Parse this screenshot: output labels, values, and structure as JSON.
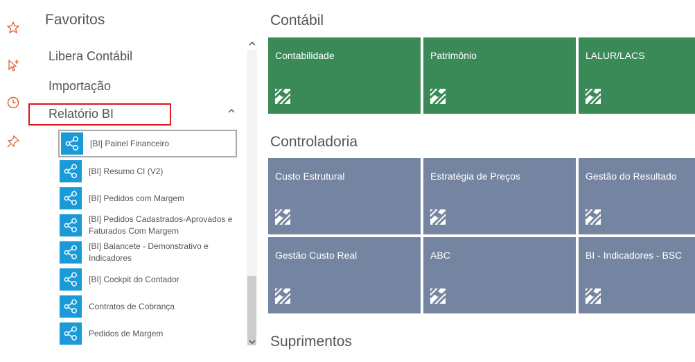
{
  "rail": {
    "icons": [
      "star-icon",
      "cursor-plus-icon",
      "clock-icon",
      "pin-icon"
    ],
    "accent_color": "#e0592a"
  },
  "favorites": {
    "title": "Favoritos",
    "items": [
      {
        "label": "Libera Contábil"
      },
      {
        "label": "Importação"
      },
      {
        "label": "Relatório BI",
        "expanded": true
      }
    ],
    "highlight_color": "#e0161b",
    "reports": [
      {
        "label": "[BI] Painel Financeiro",
        "selected": true
      },
      {
        "label": "[BI] Resumo CI (V2)"
      },
      {
        "label": "[BI] Pedidos com Margem"
      },
      {
        "label": "[BI] Pedidos Cadastrados-Aprovados e Faturados Com Margem"
      },
      {
        "label": "[BI] Balancete - Demonstrativo e Indicadores"
      },
      {
        "label": "[BI] Cockpit do Contador"
      },
      {
        "label": "Contratos de Cobrança"
      },
      {
        "label": "Pedidos de Margem"
      }
    ],
    "report_icon_color": "#1a9ad6"
  },
  "sections": [
    {
      "title": "Contábil",
      "color": "#3a8a57",
      "tiles": [
        {
          "label": "Contabilidade"
        },
        {
          "label": "Patrimônio"
        },
        {
          "label": "LALUR/LACS"
        }
      ]
    },
    {
      "title": "Controladoria",
      "color": "#7584a0",
      "tiles": [
        {
          "label": "Custo Estrutural"
        },
        {
          "label": "Estratégia de Preços"
        },
        {
          "label": "Gestão do Resultado"
        },
        {
          "label": "Gestão Custo Real"
        },
        {
          "label": "ABC"
        },
        {
          "label": "BI - Indicadores - BSC"
        }
      ]
    },
    {
      "title": "Suprimentos",
      "tiles": []
    }
  ]
}
